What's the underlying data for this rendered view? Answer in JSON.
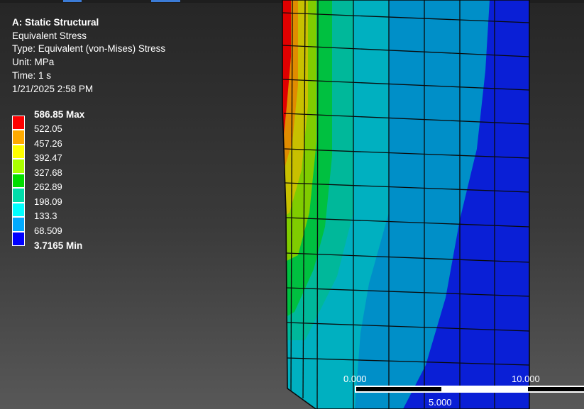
{
  "header": {
    "analysis": "A: Static Structural",
    "result": "Equivalent Stress",
    "type": "Type: Equivalent (von-Mises) Stress",
    "unit": "Unit: MPa",
    "time": "Time: 1 s",
    "timestamp": "1/21/2025 2:58 PM"
  },
  "legend": {
    "max_label": "586.85 Max",
    "min_label": "3.7165 Min",
    "values": [
      "522.05",
      "457.26",
      "392.47",
      "327.68",
      "262.89",
      "198.09",
      "133.3",
      "68.509"
    ],
    "colors": [
      "#ff0000",
      "#ffaa00",
      "#ffff00",
      "#aaff00",
      "#00dd00",
      "#00ddaa",
      "#00ffff",
      "#00aaff",
      "#0000ff"
    ]
  },
  "scale_bar": {
    "label_start": "0.000",
    "label_mid": "5.000",
    "label_end": "10.000"
  }
}
